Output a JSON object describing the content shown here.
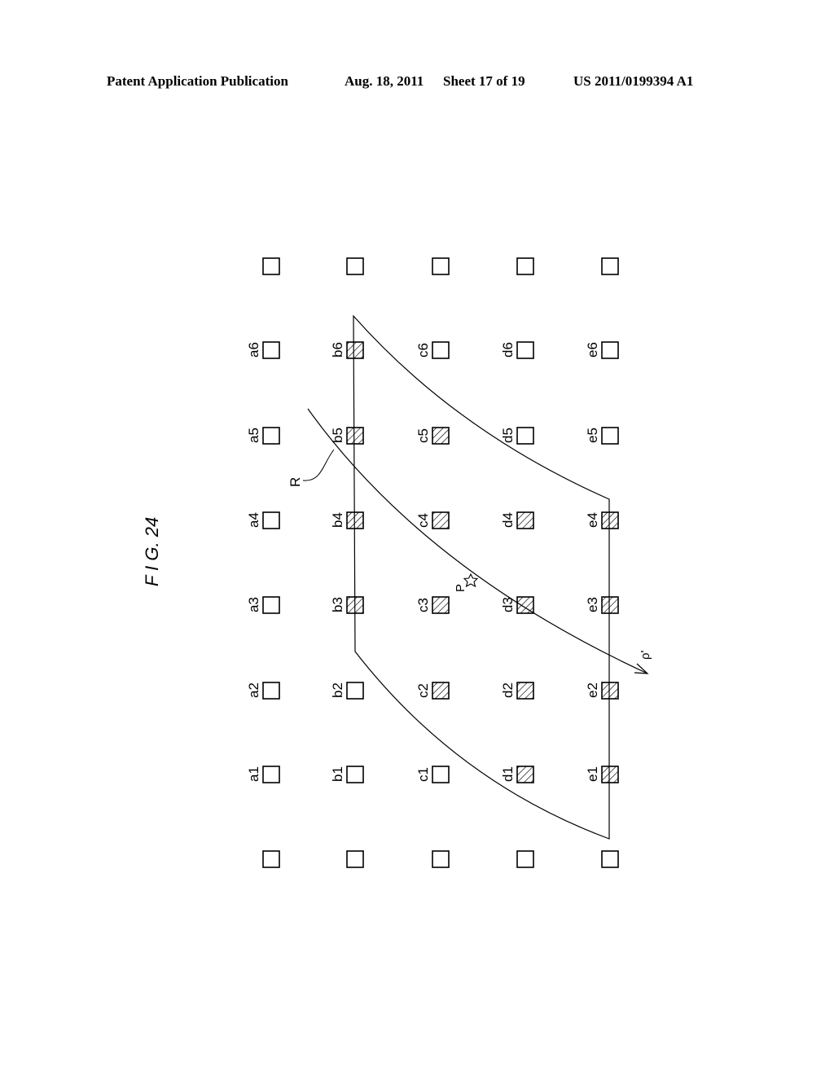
{
  "header": {
    "left": "Patent Application Publication",
    "date": "Aug. 18, 2011",
    "sheet": "Sheet 17 of 19",
    "number": "US 2011/0199394 A1"
  },
  "figure": {
    "label": "F I G. 24",
    "curve_label": "R",
    "point_label": "P",
    "arrow_label": "ρ'",
    "grid": {
      "columns": [
        "a",
        "b",
        "c",
        "d",
        "e"
      ],
      "rows": [
        "top",
        "6",
        "5",
        "4",
        "3",
        "2",
        "1",
        "bottom"
      ],
      "cells": [
        {
          "id": "a6",
          "hatched": false
        },
        {
          "id": "b6",
          "hatched": true
        },
        {
          "id": "c6",
          "hatched": false
        },
        {
          "id": "d6",
          "hatched": false
        },
        {
          "id": "e6",
          "hatched": false
        },
        {
          "id": "a5",
          "hatched": false
        },
        {
          "id": "b5",
          "hatched": true
        },
        {
          "id": "c5",
          "hatched": true
        },
        {
          "id": "d5",
          "hatched": false
        },
        {
          "id": "e5",
          "hatched": false
        },
        {
          "id": "a4",
          "hatched": false
        },
        {
          "id": "b4",
          "hatched": true
        },
        {
          "id": "c4",
          "hatched": true
        },
        {
          "id": "d4",
          "hatched": true
        },
        {
          "id": "e4",
          "hatched": true
        },
        {
          "id": "a3",
          "hatched": false
        },
        {
          "id": "b3",
          "hatched": true
        },
        {
          "id": "c3",
          "hatched": true
        },
        {
          "id": "d3",
          "hatched": true
        },
        {
          "id": "e3",
          "hatched": true
        },
        {
          "id": "a2",
          "hatched": false
        },
        {
          "id": "b2",
          "hatched": false
        },
        {
          "id": "c2",
          "hatched": true
        },
        {
          "id": "d2",
          "hatched": true
        },
        {
          "id": "e2",
          "hatched": true
        },
        {
          "id": "a1",
          "hatched": false
        },
        {
          "id": "b1",
          "hatched": false
        },
        {
          "id": "c1",
          "hatched": false
        },
        {
          "id": "d1",
          "hatched": true
        },
        {
          "id": "e1",
          "hatched": true
        }
      ]
    }
  }
}
